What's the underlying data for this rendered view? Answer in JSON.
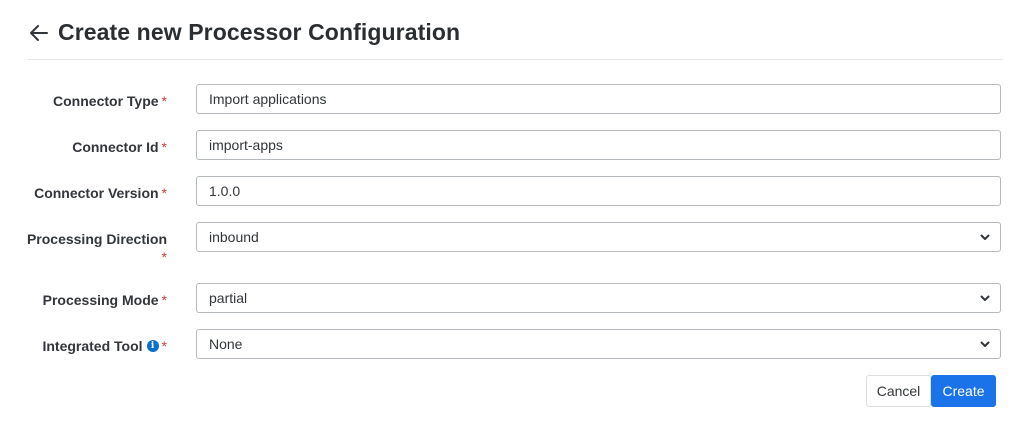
{
  "header": {
    "title": "Create new Processor Configuration"
  },
  "form": {
    "connector_type": {
      "label": "Connector Type",
      "required_mark": "*",
      "value": "Import applications"
    },
    "connector_id": {
      "label": "Connector Id",
      "required_mark": "*",
      "value": "import-apps"
    },
    "connector_version": {
      "label": "Connector Version",
      "required_mark": "*",
      "value": "1.0.0"
    },
    "processing_direction": {
      "label": "Processing Direction",
      "required_mark": "*",
      "selected": "inbound"
    },
    "processing_mode": {
      "label": "Processing Mode",
      "required_mark": "*",
      "selected": "partial"
    },
    "integrated_tool": {
      "label": "Integrated Tool",
      "info_icon_text": "i",
      "required_mark": "*",
      "selected": "None"
    }
  },
  "actions": {
    "cancel_label": "Cancel",
    "create_label": "Create"
  },
  "colors": {
    "primary": "#1a73e8",
    "required": "#d13b3b",
    "info": "#0a6ed1",
    "border": "#b4b9be"
  },
  "icons": {
    "back": "arrow-left-icon",
    "chevron": "chevron-down-icon",
    "info": "info-icon"
  }
}
